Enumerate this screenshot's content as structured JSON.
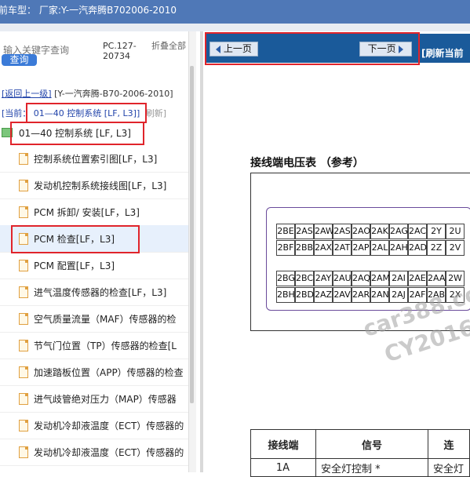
{
  "top": {
    "vehicle_label": "前车型：  厂家:Y-一汽奔腾B702006-2010"
  },
  "search": {
    "placeholder": "输入关键字查询",
    "button": "查询"
  },
  "pc_code": "PC.127-20734",
  "collapse_all": "折叠全部",
  "back": {
    "link": "[返回上一级]",
    "path": "[Y-一汽奔腾-B70-2006-2010]"
  },
  "current": {
    "prefix": "[当前：",
    "value": "01—40 控制系统 [LF, L3]]",
    "refresh": "刷新]"
  },
  "folder": {
    "label": "01—40 控制系统 [LF, L3]"
  },
  "tree": [
    {
      "label": "控制系统位置索引图[LF，L3]"
    },
    {
      "label": "发动机控制系统接线图[LF，L3]"
    },
    {
      "label": "PCM 拆卸/ 安装[LF，L3]"
    },
    {
      "label": "PCM 检查[LF，L3]"
    },
    {
      "label": "PCM 配置[LF，L3]"
    },
    {
      "label": "进气温度传感器的检查[LF，L3]"
    },
    {
      "label": "空气质量流量（MAF）传感器的检"
    },
    {
      "label": "节气门位置（TP）传感器的检查[L"
    },
    {
      "label": "加速踏板位置（APP）传感器的检查"
    },
    {
      "label": "进气歧管绝对压力（MAP）传感器"
    },
    {
      "label": "发动机冷却液温度（ECT）传感器的"
    },
    {
      "label": "发动机冷却液温度（ECT）传感器的"
    }
  ],
  "nav": {
    "prev": "上一页",
    "next": "下一页",
    "refresh": "[刷新当前"
  },
  "doc": {
    "title": "接线端电压表 （参考）"
  },
  "connector_rows": [
    [
      "2BE",
      "2AS",
      "2AW",
      "2AS",
      "2AO",
      "2AK",
      "2AG",
      "2AC",
      "2Y",
      "2U"
    ],
    [
      "2BF",
      "2BB",
      "2AX",
      "2AT",
      "2AP",
      "2AL",
      "2AH",
      "2AD",
      "2Z",
      "2V"
    ],
    [
      "2BG",
      "2BC",
      "2AY",
      "2AU",
      "2AQ",
      "2AM",
      "2AI",
      "2AE",
      "2AA",
      "2W"
    ],
    [
      "2BH",
      "2BD",
      "2AZ",
      "2AV",
      "2AR",
      "2AN",
      "2AJ",
      "2AF",
      "2AB",
      "2X"
    ]
  ],
  "watermark": {
    "line1": "car388.co",
    "line2": "CY2016"
  },
  "table": {
    "headers": [
      "接线端",
      "信号",
      "连"
    ],
    "row1": [
      "1A",
      "安全灯控制 *",
      "安全灯"
    ]
  }
}
